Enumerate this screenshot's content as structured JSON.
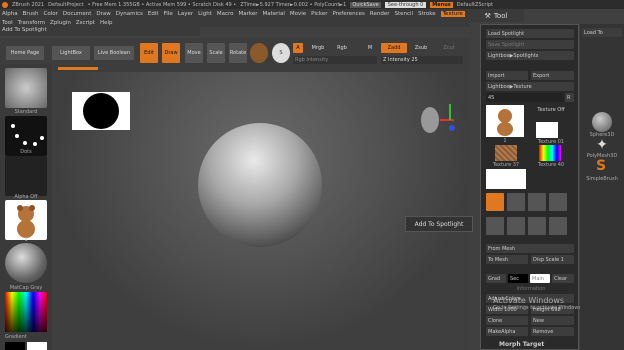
{
  "titlebar": {
    "app_title": "ZBrush 2021",
    "project": "DefaultProject",
    "mem": "• Free Mem 1.355GB • Active Mem 599 • Scratch Disk 49 •",
    "ztime": "ZTime►5.927 Timer►0.002 • PolyCount►1",
    "quicksave": "QuickSave",
    "see_through": "See-through 0",
    "menus": "Menus",
    "script": "DefaultZScript"
  },
  "menu_row1": [
    "Alpha",
    "Brush",
    "Color",
    "Document",
    "Draw",
    "Dynamics",
    "Edit",
    "File",
    "Layer",
    "Light",
    "Macro",
    "Marker",
    "Material",
    "Movie",
    "Picker",
    "Preferences",
    "Render",
    "Stencil",
    "Stroke",
    "Texture"
  ],
  "menu_row2": [
    "Tool",
    "Transform",
    "Zplugin",
    "Zscript",
    "Help"
  ],
  "menu_row3": "Add To Spotlight",
  "toolbar": {
    "home": "Home Page",
    "lightbox": "LightBox",
    "live_boolean": "Live Boolean",
    "edit": "Edit",
    "draw": "Draw",
    "move": "Move",
    "scale": "Scale",
    "rotate": "Rotate",
    "a": "A",
    "mrgb": "Mrgb",
    "rgb": "Rgb",
    "m": "M",
    "zadd": "Zadd",
    "zsub": "Zsub",
    "zcut": "Zcut",
    "rgb_intensity": "Rgb Intensity",
    "z_intensity": "Z Intensity 25",
    "tool_tab": "Tool"
  },
  "left": {
    "standard": "Standard",
    "dots": "Dots",
    "alpha_off": "Alpha Off",
    "texture_num": "1",
    "matcap": "MatCap Gray",
    "gradient": "Gradient"
  },
  "tooltip": "Add To Spotlight",
  "panel": {
    "load_spotlight": "Load Spotlight",
    "save_spotlight": "Save Spotlight",
    "lightbox_spotlights": "Lightbox▶Spotlights",
    "import": "Import",
    "export": "Export",
    "lightbox_texture": "Lightbox▶Texture",
    "slider_val": "45",
    "r": "R",
    "texture_off": "Texture Off",
    "t1": "1",
    "texture01": "Texture 01",
    "texture37": "Texture 37",
    "texture40": "Texture 40",
    "from_mesh": "From Mesh",
    "to_mesh": "To Mesh",
    "disp_scale": "Disp Scale 1",
    "grad": "Grad",
    "sec": "Sec",
    "main": "Main",
    "clear": "Clear",
    "information": "Information",
    "adjust_colors": "Adjust Colors",
    "width": "Width 1000",
    "height": "Height 698",
    "clone": "Clone",
    "new": "New",
    "make_alpha": "MakeAlpha",
    "remove": "Remove",
    "activate": "Activate Windows",
    "activate_sub": "Go to Settings to activate Windows.",
    "morph": "Morph Target"
  },
  "farright": {
    "load_tool": "Load To",
    "sphere3d": "Sphere3D",
    "polymesh": "PolyMesh3D",
    "simplebrush": "SimpleBrush"
  }
}
